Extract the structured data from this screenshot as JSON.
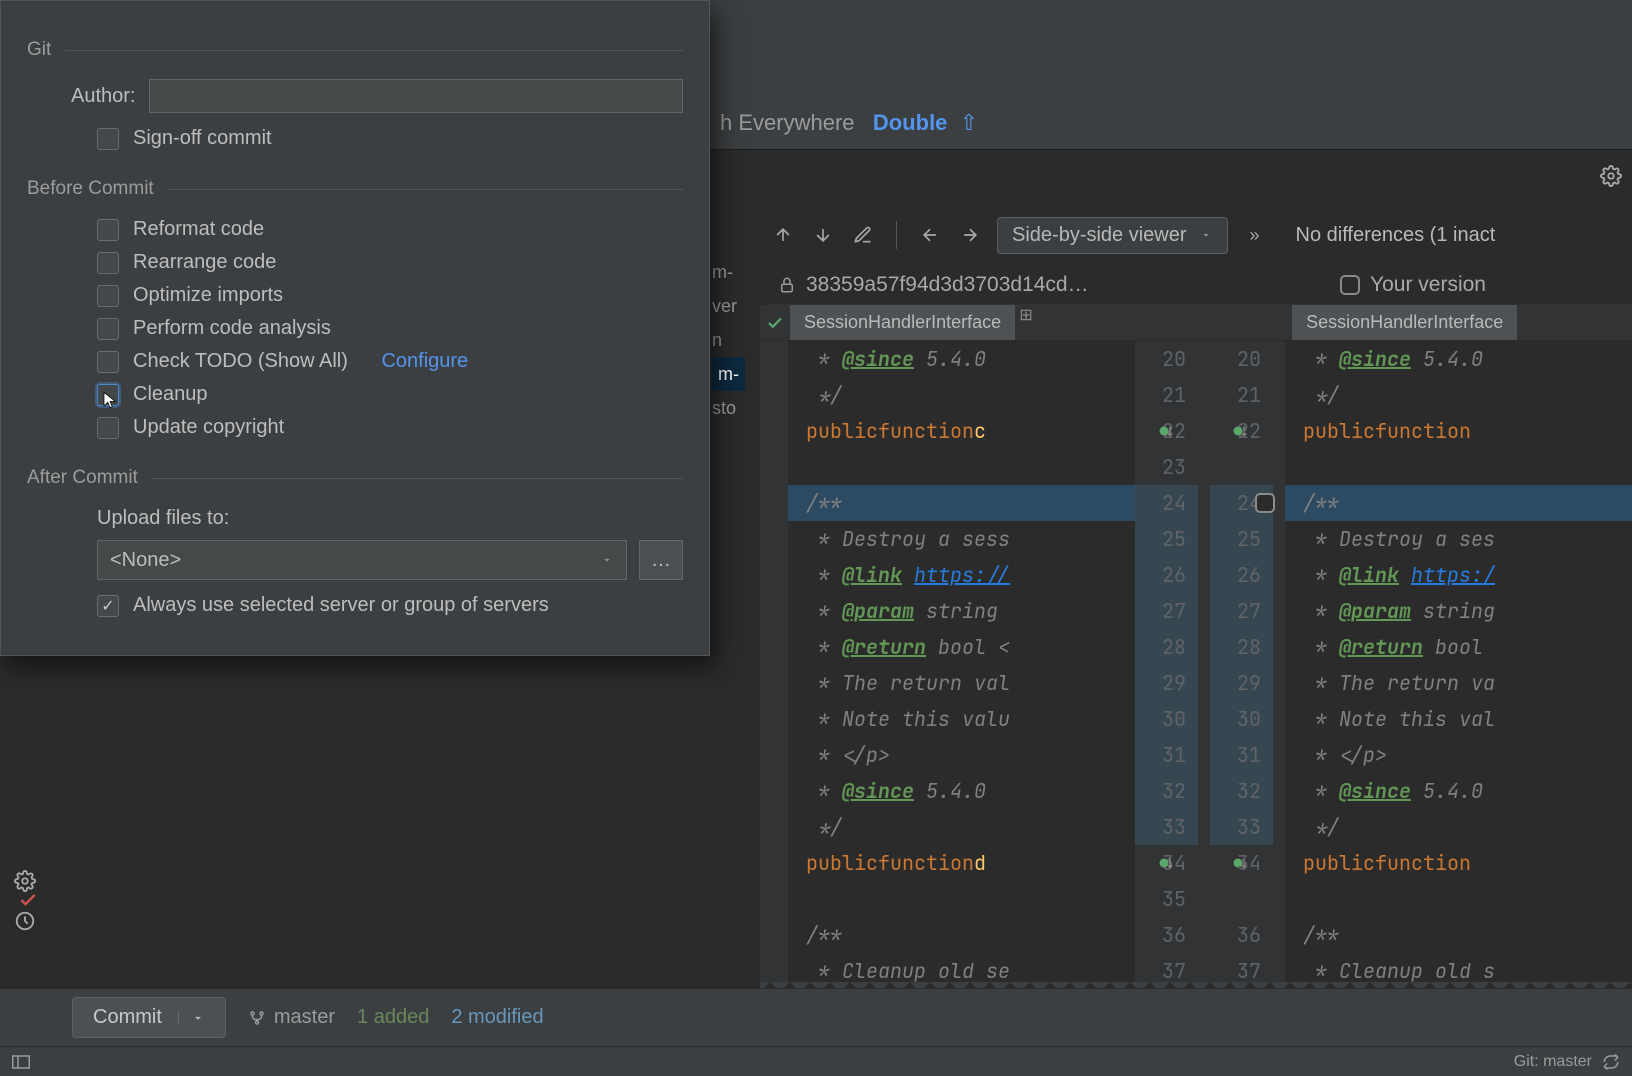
{
  "search_hint": {
    "prefix": "h Everywhere",
    "key": "Double",
    "arrow": "⇧"
  },
  "diff_toolbar": {
    "view_mode": "Side-by-side viewer",
    "status": "No differences (1 inact"
  },
  "versions": {
    "left_hash": "38359a57f94d3d3703d14cd…",
    "right_label": "Your version"
  },
  "tabs": {
    "name": "SessionHandlerInterface"
  },
  "gutters": {
    "left": [
      "20",
      "21",
      "22",
      "23",
      "24",
      "25",
      "26",
      "27",
      "28",
      "29",
      "30",
      "31",
      "32",
      "33",
      "34",
      "35",
      "36",
      "37"
    ],
    "right": [
      "20",
      "21",
      "22",
      "",
      "24",
      "25",
      "26",
      "27",
      "28",
      "29",
      "30",
      "31",
      "32",
      "33",
      "34",
      "",
      "36",
      "37"
    ]
  },
  "code_left": [
    " * @since 5.4.0",
    " */",
    "public function c",
    "",
    "/**",
    " * Destroy a sess",
    " * @link https://",
    " * @param string ",
    " * @return bool <",
    " * The return val",
    " * Note this valu",
    " * </p>",
    " * @since 5.4.0",
    " */",
    "public function d",
    "",
    "/**",
    " * Cleanup old se"
  ],
  "code_right": [
    " * @since 5.4.0",
    " */",
    "public function ",
    "",
    "/**",
    " * Destroy a ses",
    " * @link https:/",
    " * @param string",
    " * @return bool ",
    " * The return va",
    " * Note this val",
    " * </p>",
    " * @since 5.4.0",
    " */",
    "public function ",
    "",
    "/**",
    " * Cleanup old s"
  ],
  "popup": {
    "git_title": "Git",
    "author_label": "Author:",
    "signoff": "Sign-off commit",
    "before_title": "Before Commit",
    "checks": {
      "reformat": "Reformat code",
      "rearrange": "Rearrange code",
      "optimize": "Optimize imports",
      "analysis": "Perform code analysis",
      "todo": "Check TODO (Show All)",
      "todo_link": "Configure",
      "cleanup": "Cleanup",
      "copyright": "Update copyright"
    },
    "after_title": "After Commit",
    "upload_label": "Upload files to:",
    "upload_value": "<None>",
    "always_use": "Always use selected server or group of servers"
  },
  "bottom": {
    "commit": "Commit",
    "branch": "master",
    "added": "1 added",
    "modified": "2 modified"
  },
  "status": {
    "git": "Git: master"
  },
  "bg_frags": [
    "m-",
    "ver",
    "n",
    "m-",
    "sto"
  ]
}
